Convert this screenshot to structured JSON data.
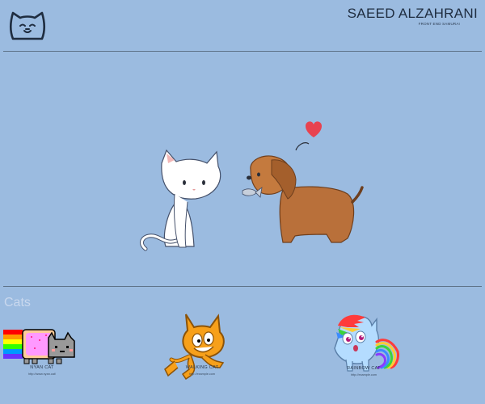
{
  "header": {
    "title": "SAEED ALZAHRANI",
    "subtitle": "FRONT END SAMURAI",
    "logo_icon": "cat-face-icon"
  },
  "hero": {
    "image": "cat-meets-dog-with-fish-and-heart"
  },
  "section": {
    "title": "Cats"
  },
  "cards": [
    {
      "name": "NYAN CAT",
      "link": "http://www.nyan.cat/",
      "image": "nyan-cat"
    },
    {
      "name": "WALKING CAT",
      "link": "http://example.com",
      "image": "scratch-walking-cat"
    },
    {
      "name": "RAINBOW CAT",
      "link": "http://example.com",
      "image": "rainbow-cat"
    }
  ],
  "colors": {
    "background": "#9bbbe0",
    "text_dark": "#1f2d40",
    "section_title": "#c9d8ee",
    "divider": "#5f7389"
  }
}
